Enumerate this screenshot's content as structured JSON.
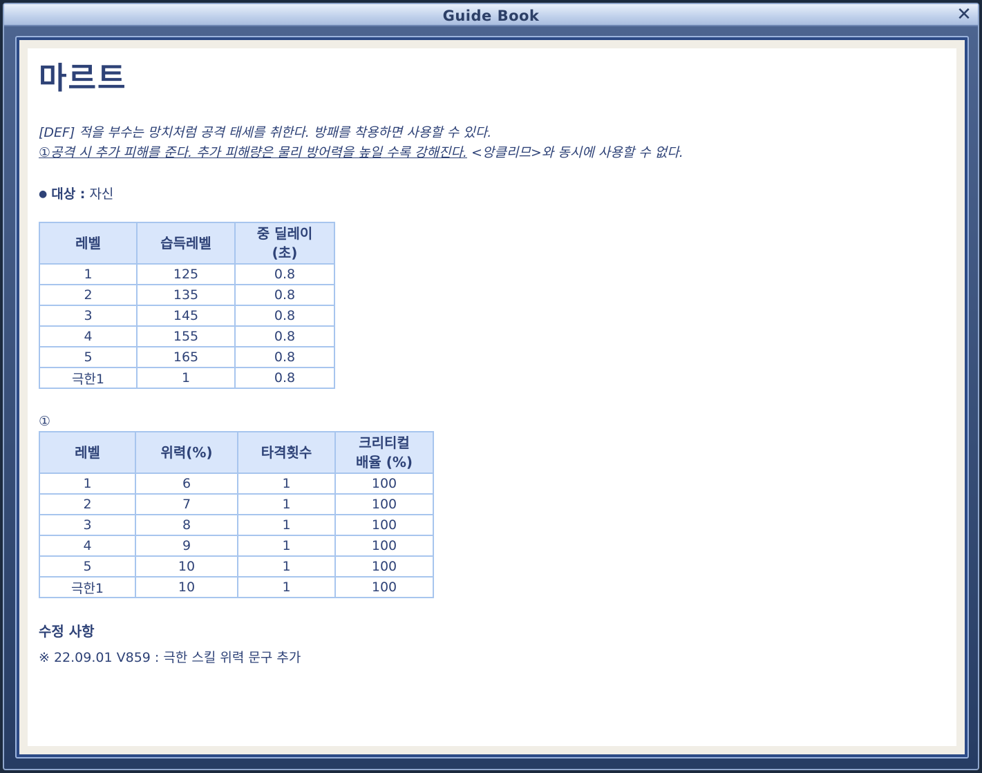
{
  "window": {
    "title": "Guide Book",
    "close_glyph": "✕"
  },
  "skill": {
    "name": "마르트",
    "desc_line1": "[DEF] 적을 부수는 망치처럼 공격 태세를 취한다. 방패를 착용하면 사용할 수 있다.",
    "desc_line2_underlined": "①공격 시 추가 피해를 준다. 추가 피해량은 물리 방어력을 높일 수록 강해진다.",
    "desc_line2_rest": " <앙클리므>와 동시에 사용할 수 없다.",
    "target_label": "대상 :",
    "target_value": " 자신"
  },
  "table1": {
    "headers": [
      "레벨",
      "습득레벨",
      "중 딜레이\n(초)"
    ],
    "rows": [
      [
        "1",
        "125",
        "0.8"
      ],
      [
        "2",
        "135",
        "0.8"
      ],
      [
        "3",
        "145",
        "0.8"
      ],
      [
        "4",
        "155",
        "0.8"
      ],
      [
        "5",
        "165",
        "0.8"
      ],
      [
        "극한1",
        "1",
        "0.8"
      ]
    ]
  },
  "footnote_mark": "①",
  "table2": {
    "headers": [
      "레벨",
      "위력(%)",
      "타격횟수",
      "크리티컬\n배율 (%)"
    ],
    "rows": [
      [
        "1",
        "6",
        "1",
        "100"
      ],
      [
        "2",
        "7",
        "1",
        "100"
      ],
      [
        "3",
        "8",
        "1",
        "100"
      ],
      [
        "4",
        "9",
        "1",
        "100"
      ],
      [
        "5",
        "10",
        "1",
        "100"
      ],
      [
        "극한1",
        "10",
        "1",
        "100"
      ]
    ]
  },
  "changes": {
    "title": "수정 사항",
    "items": [
      "※ 22.09.01 V859 : 극한 스킬 위력 문구 추가"
    ]
  },
  "colors": {
    "text": "#2e4277",
    "header_bg": "#d9e6fb",
    "border": "#a7c5ee"
  }
}
